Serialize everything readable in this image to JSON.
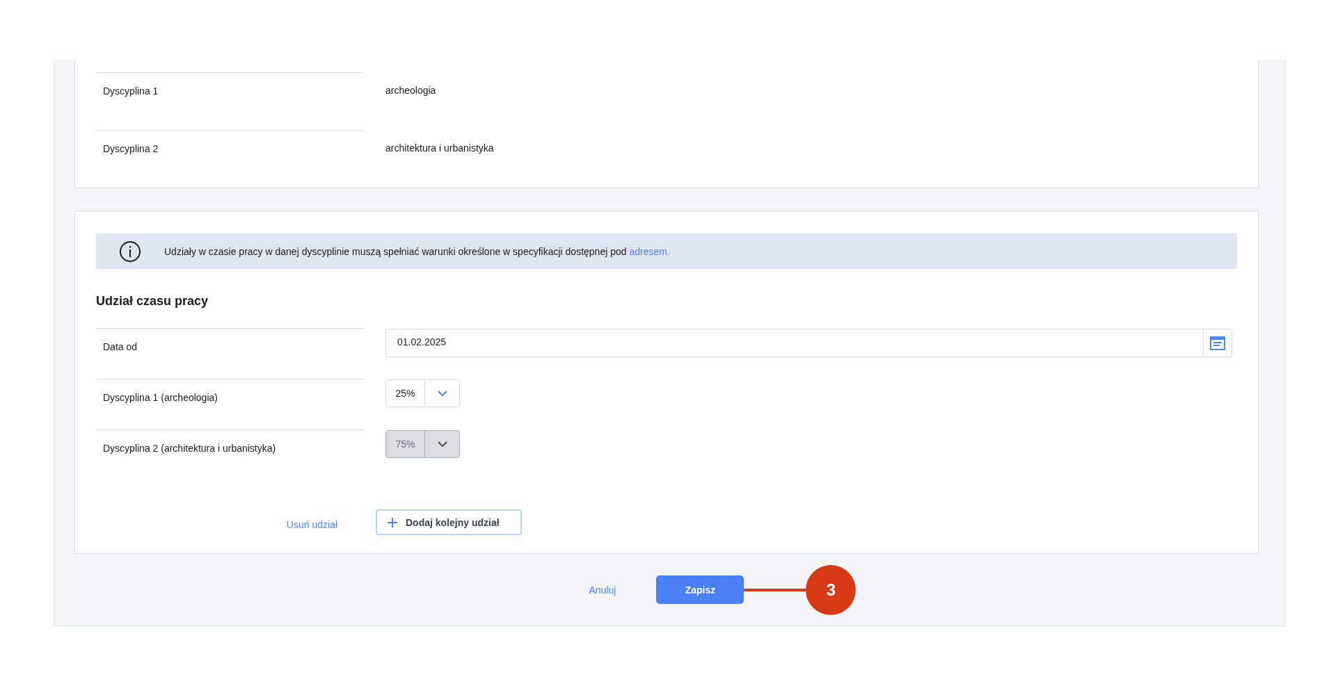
{
  "details": [
    {
      "label": "Dyscyplina 1",
      "value": "archeologia"
    },
    {
      "label": "Dyscyplina 2",
      "value": "architektura i urbanistyka"
    }
  ],
  "info": {
    "text": "Udziały w czasie pracy w danej dyscyplinie muszą spełniać warunki określone w specyfikacji dostępnej pod",
    "link": "adresem."
  },
  "section_title": "Udział czasu pracy",
  "date_field": {
    "label": "Data od",
    "value": "01.02.2025"
  },
  "shares": [
    {
      "label": "Dyscyplina 1 (archeologia)",
      "value": "25%",
      "disabled": false
    },
    {
      "label": "Dyscyplina 2 (architektura i urbanistyka)",
      "value": "75%",
      "disabled": true
    }
  ],
  "remove_link": "Usuń udział",
  "add_button": "Dodaj kolejny udział",
  "cancel": "Anuluj",
  "save": "Zapisz",
  "callout": {
    "number": "3"
  }
}
